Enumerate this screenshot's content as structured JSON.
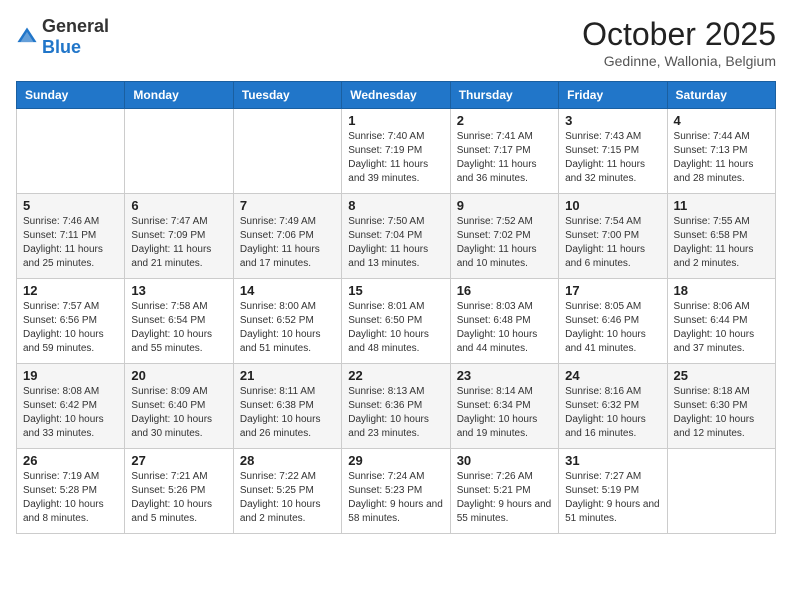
{
  "header": {
    "logo_general": "General",
    "logo_blue": "Blue",
    "month_title": "October 2025",
    "location": "Gedinne, Wallonia, Belgium"
  },
  "weekdays": [
    "Sunday",
    "Monday",
    "Tuesday",
    "Wednesday",
    "Thursday",
    "Friday",
    "Saturday"
  ],
  "weeks": [
    [
      {
        "day": "",
        "info": ""
      },
      {
        "day": "",
        "info": ""
      },
      {
        "day": "",
        "info": ""
      },
      {
        "day": "1",
        "info": "Sunrise: 7:40 AM\nSunset: 7:19 PM\nDaylight: 11 hours\nand 39 minutes."
      },
      {
        "day": "2",
        "info": "Sunrise: 7:41 AM\nSunset: 7:17 PM\nDaylight: 11 hours\nand 36 minutes."
      },
      {
        "day": "3",
        "info": "Sunrise: 7:43 AM\nSunset: 7:15 PM\nDaylight: 11 hours\nand 32 minutes."
      },
      {
        "day": "4",
        "info": "Sunrise: 7:44 AM\nSunset: 7:13 PM\nDaylight: 11 hours\nand 28 minutes."
      }
    ],
    [
      {
        "day": "5",
        "info": "Sunrise: 7:46 AM\nSunset: 7:11 PM\nDaylight: 11 hours\nand 25 minutes."
      },
      {
        "day": "6",
        "info": "Sunrise: 7:47 AM\nSunset: 7:09 PM\nDaylight: 11 hours\nand 21 minutes."
      },
      {
        "day": "7",
        "info": "Sunrise: 7:49 AM\nSunset: 7:06 PM\nDaylight: 11 hours\nand 17 minutes."
      },
      {
        "day": "8",
        "info": "Sunrise: 7:50 AM\nSunset: 7:04 PM\nDaylight: 11 hours\nand 13 minutes."
      },
      {
        "day": "9",
        "info": "Sunrise: 7:52 AM\nSunset: 7:02 PM\nDaylight: 11 hours\nand 10 minutes."
      },
      {
        "day": "10",
        "info": "Sunrise: 7:54 AM\nSunset: 7:00 PM\nDaylight: 11 hours\nand 6 minutes."
      },
      {
        "day": "11",
        "info": "Sunrise: 7:55 AM\nSunset: 6:58 PM\nDaylight: 11 hours\nand 2 minutes."
      }
    ],
    [
      {
        "day": "12",
        "info": "Sunrise: 7:57 AM\nSunset: 6:56 PM\nDaylight: 10 hours\nand 59 minutes."
      },
      {
        "day": "13",
        "info": "Sunrise: 7:58 AM\nSunset: 6:54 PM\nDaylight: 10 hours\nand 55 minutes."
      },
      {
        "day": "14",
        "info": "Sunrise: 8:00 AM\nSunset: 6:52 PM\nDaylight: 10 hours\nand 51 minutes."
      },
      {
        "day": "15",
        "info": "Sunrise: 8:01 AM\nSunset: 6:50 PM\nDaylight: 10 hours\nand 48 minutes."
      },
      {
        "day": "16",
        "info": "Sunrise: 8:03 AM\nSunset: 6:48 PM\nDaylight: 10 hours\nand 44 minutes."
      },
      {
        "day": "17",
        "info": "Sunrise: 8:05 AM\nSunset: 6:46 PM\nDaylight: 10 hours\nand 41 minutes."
      },
      {
        "day": "18",
        "info": "Sunrise: 8:06 AM\nSunset: 6:44 PM\nDaylight: 10 hours\nand 37 minutes."
      }
    ],
    [
      {
        "day": "19",
        "info": "Sunrise: 8:08 AM\nSunset: 6:42 PM\nDaylight: 10 hours\nand 33 minutes."
      },
      {
        "day": "20",
        "info": "Sunrise: 8:09 AM\nSunset: 6:40 PM\nDaylight: 10 hours\nand 30 minutes."
      },
      {
        "day": "21",
        "info": "Sunrise: 8:11 AM\nSunset: 6:38 PM\nDaylight: 10 hours\nand 26 minutes."
      },
      {
        "day": "22",
        "info": "Sunrise: 8:13 AM\nSunset: 6:36 PM\nDaylight: 10 hours\nand 23 minutes."
      },
      {
        "day": "23",
        "info": "Sunrise: 8:14 AM\nSunset: 6:34 PM\nDaylight: 10 hours\nand 19 minutes."
      },
      {
        "day": "24",
        "info": "Sunrise: 8:16 AM\nSunset: 6:32 PM\nDaylight: 10 hours\nand 16 minutes."
      },
      {
        "day": "25",
        "info": "Sunrise: 8:18 AM\nSunset: 6:30 PM\nDaylight: 10 hours\nand 12 minutes."
      }
    ],
    [
      {
        "day": "26",
        "info": "Sunrise: 7:19 AM\nSunset: 5:28 PM\nDaylight: 10 hours\nand 8 minutes."
      },
      {
        "day": "27",
        "info": "Sunrise: 7:21 AM\nSunset: 5:26 PM\nDaylight: 10 hours\nand 5 minutes."
      },
      {
        "day": "28",
        "info": "Sunrise: 7:22 AM\nSunset: 5:25 PM\nDaylight: 10 hours\nand 2 minutes."
      },
      {
        "day": "29",
        "info": "Sunrise: 7:24 AM\nSunset: 5:23 PM\nDaylight: 9 hours\nand 58 minutes."
      },
      {
        "day": "30",
        "info": "Sunrise: 7:26 AM\nSunset: 5:21 PM\nDaylight: 9 hours\nand 55 minutes."
      },
      {
        "day": "31",
        "info": "Sunrise: 7:27 AM\nSunset: 5:19 PM\nDaylight: 9 hours\nand 51 minutes."
      },
      {
        "day": "",
        "info": ""
      }
    ]
  ]
}
